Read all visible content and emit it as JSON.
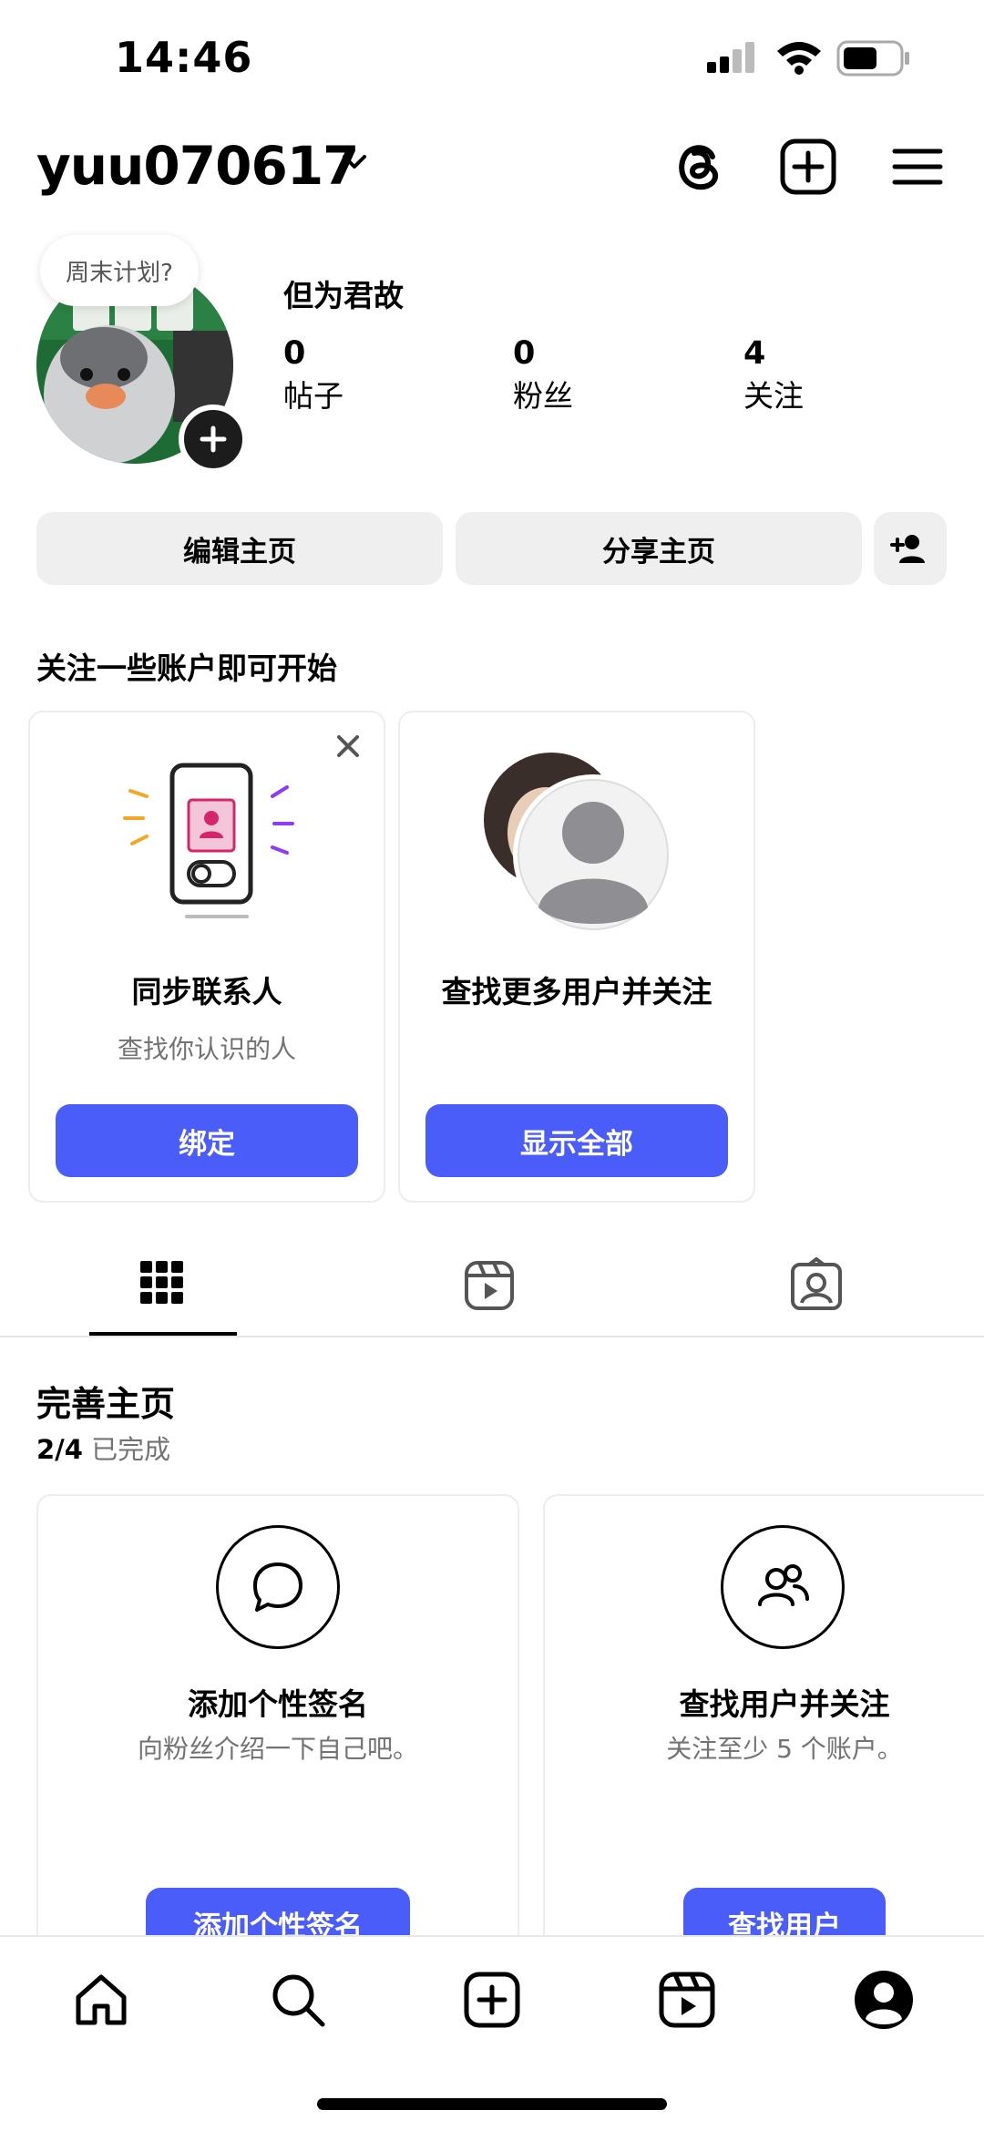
{
  "status_bar": {
    "time": "14:46"
  },
  "header": {
    "username": "yuu070617"
  },
  "profile": {
    "note": "周末计划?",
    "display_name": "但为君故",
    "stats": [
      {
        "value": "0",
        "label": "帖子"
      },
      {
        "value": "0",
        "label": "粉丝"
      },
      {
        "value": "4",
        "label": "关注"
      }
    ],
    "edit_button": "编辑主页",
    "share_button": "分享主页"
  },
  "suggestions": {
    "title": "关注一些账户即可开始",
    "cards": [
      {
        "title": "同步联系人",
        "subtitle": "查找你认识的人",
        "button": "绑定"
      },
      {
        "title": "查找更多用户并关注",
        "subtitle": "",
        "button": "显示全部"
      }
    ]
  },
  "complete_profile": {
    "title": "完善主页",
    "progress_done": "2/4",
    "progress_suffix": "已完成",
    "cards": [
      {
        "title": "添加个性签名",
        "subtitle": "向粉丝介绍一下自己吧。",
        "button": "添加个性签名"
      },
      {
        "title": "查找用户并关注",
        "subtitle": "关注至少 5 个账户。",
        "button": "查找用户"
      }
    ]
  },
  "colors": {
    "accent": "#4a5df9",
    "button_gray": "#efefef"
  }
}
